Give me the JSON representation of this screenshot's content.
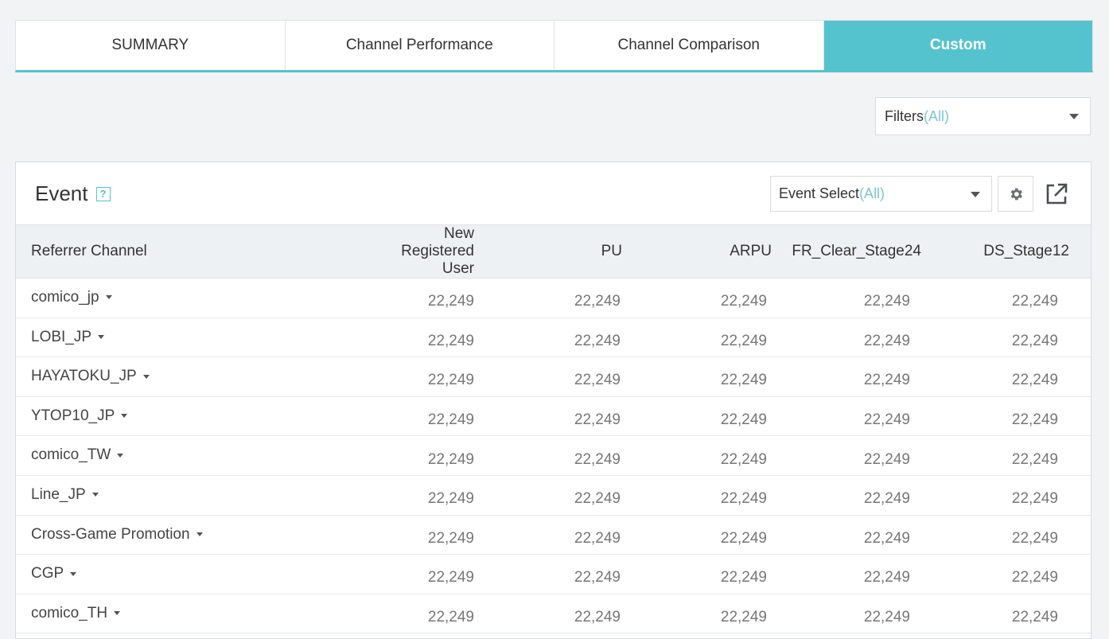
{
  "tabs": [
    "SUMMARY",
    "Channel Performance",
    "Channel Comparison",
    "Custom"
  ],
  "active_tab": "Custom",
  "filters": {
    "label": "Filters",
    "value": "(All)"
  },
  "panel": {
    "title": "Event",
    "help": "?",
    "event_select": {
      "label": "Event Select",
      "value": "(All)"
    }
  },
  "table": {
    "columns": [
      "Referrer Channel",
      "New Registered User",
      "PU",
      "ARPU",
      "FR_Clear_Stage24",
      "DS_Stage12"
    ],
    "rows": [
      {
        "channel": "comico_jp",
        "values": [
          "22,249",
          "22,249",
          "22,249",
          "22,249",
          "22,249"
        ]
      },
      {
        "channel": "LOBI_JP",
        "values": [
          "22,249",
          "22,249",
          "22,249",
          "22,249",
          "22,249"
        ]
      },
      {
        "channel": "HAYATOKU_JP",
        "values": [
          "22,249",
          "22,249",
          "22,249",
          "22,249",
          "22,249"
        ]
      },
      {
        "channel": "YTOP10_JP",
        "values": [
          "22,249",
          "22,249",
          "22,249",
          "22,249",
          "22,249"
        ]
      },
      {
        "channel": "comico_TW",
        "values": [
          "22,249",
          "22,249",
          "22,249",
          "22,249",
          "22,249"
        ]
      },
      {
        "channel": "Line_JP",
        "values": [
          "22,249",
          "22,249",
          "22,249",
          "22,249",
          "22,249"
        ]
      },
      {
        "channel": "Cross-Game Promotion",
        "values": [
          "22,249",
          "22,249",
          "22,249",
          "22,249",
          "22,249"
        ]
      },
      {
        "channel": "CGP",
        "values": [
          "22,249",
          "22,249",
          "22,249",
          "22,249",
          "22,249"
        ]
      },
      {
        "channel": "comico_TH",
        "values": [
          "22,249",
          "22,249",
          "22,249",
          "22,249",
          "22,249"
        ]
      }
    ]
  },
  "icons": {
    "gear": "gear-icon",
    "export": "external-link-icon",
    "dropdown": "chevron-down-icon"
  },
  "colors": {
    "accent": "#55c3cd",
    "hint": "#7cc7d2"
  }
}
